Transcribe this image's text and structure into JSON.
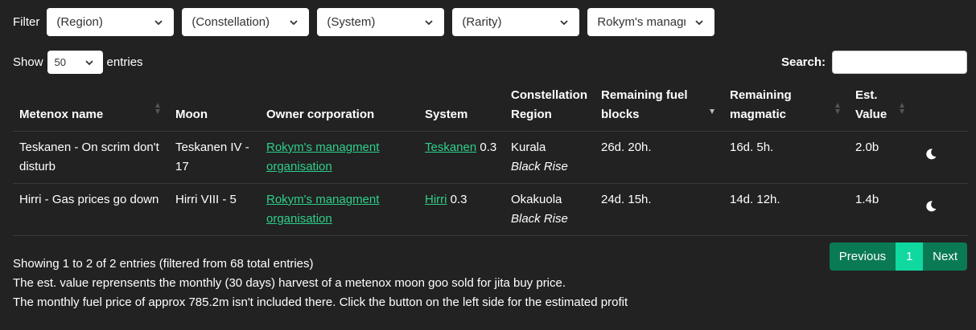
{
  "filter": {
    "label": "Filter",
    "selects": [
      {
        "value": "(Region)"
      },
      {
        "value": "(Constellation)"
      },
      {
        "value": "(System)"
      },
      {
        "value": "(Rarity)"
      },
      {
        "value": "Rokym's managment organisation"
      }
    ]
  },
  "length": {
    "show": "Show",
    "value": "50",
    "entries": "entries"
  },
  "search": {
    "label": "Search:",
    "value": ""
  },
  "table": {
    "headers": [
      "Metenox name",
      "Moon",
      "Owner corporation",
      "System",
      "Constellation",
      "Region",
      "Remaining fuel",
      "blocks",
      "Remaining",
      "magmatic",
      "Est.",
      "Value"
    ],
    "rows": [
      {
        "name": "Teskanen - On scrim don't disturb",
        "moon": "Teskanen IV - 17",
        "owner": "Rokym's managment organisation",
        "system": "Teskanen",
        "security": "0.3",
        "constellation": "Kurala",
        "region": "Black Rise",
        "fuel": "26d. 20h.",
        "magmatic": "16d. 5h.",
        "value": "2.0b",
        "action_icon": "moon-icon"
      },
      {
        "name": "Hirri - Gas prices go down",
        "moon": "Hirri VIII - 5",
        "owner": "Rokym's managment organisation",
        "system": "Hirri",
        "security": "0.3",
        "constellation": "Okakuola",
        "region": "Black Rise",
        "fuel": "24d. 15h.",
        "magmatic": "14d. 12h.",
        "value": "1.4b",
        "action_icon": "moon-icon"
      }
    ]
  },
  "info": {
    "summary": "Showing 1 to 2 of 2 entries (filtered from 68 total entries)",
    "note1": "The est. value reprensents the monthly (30 days) harvest of a metenox moon goo sold for jita buy price.",
    "note2": "The monthly fuel price of approx 785.2m isn't included there. Click the button on the left side for the estimated profit"
  },
  "pagination": {
    "previous": "Previous",
    "current": "1",
    "next": "Next"
  },
  "colors": {
    "background": "#222222",
    "link": "#2ecf8a",
    "pager": "#0a7a55",
    "pager_active": "#10d9a0"
  }
}
